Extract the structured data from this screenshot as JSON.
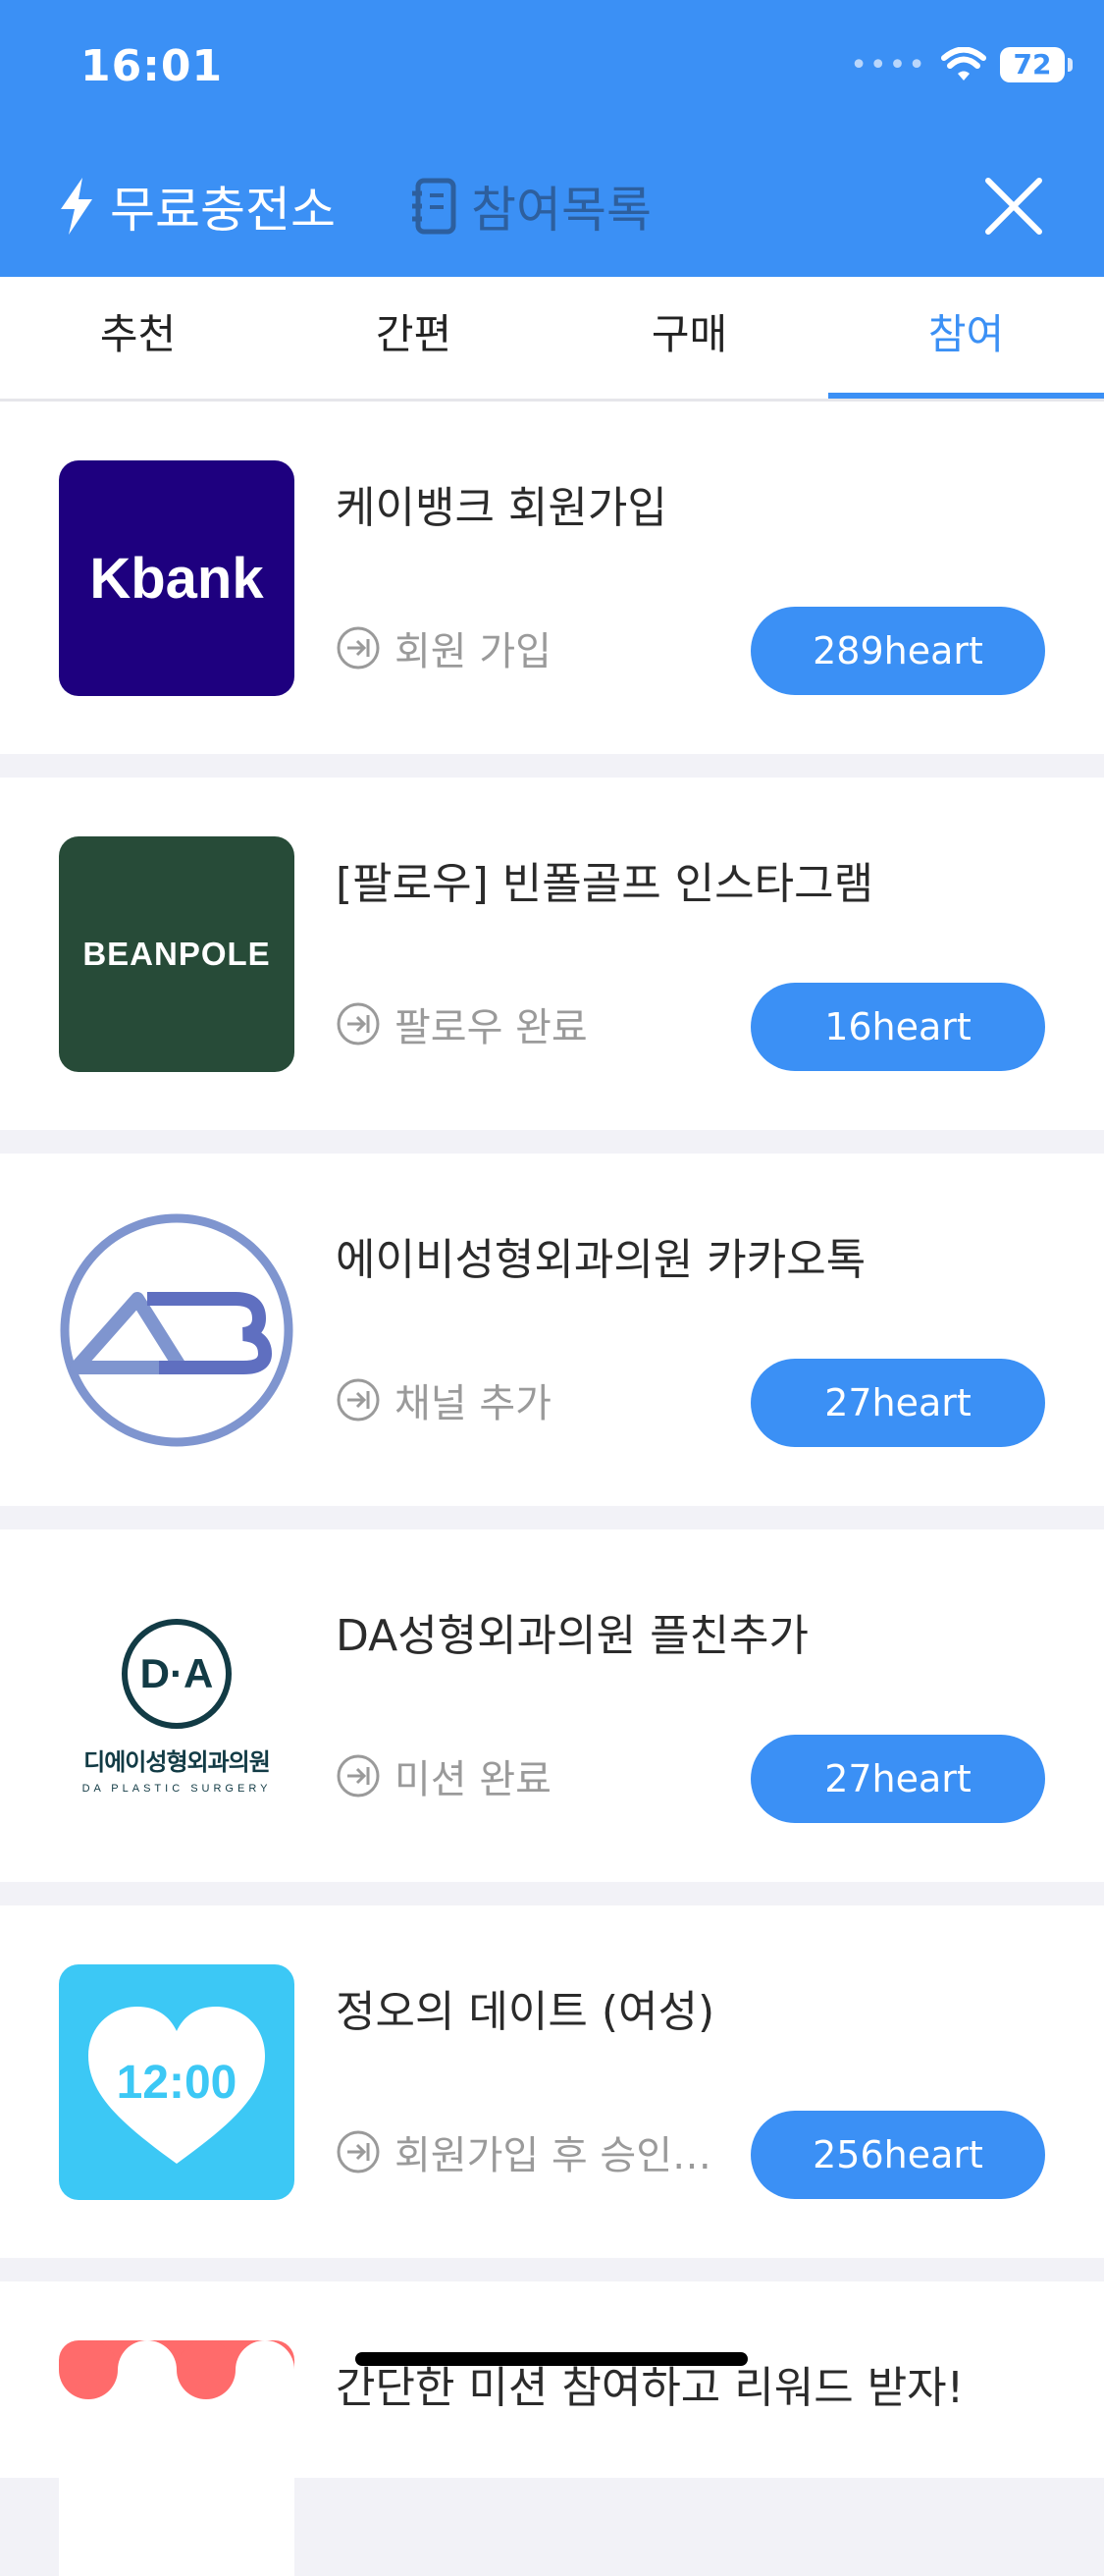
{
  "status_bar": {
    "time": "16:01",
    "battery": "72"
  },
  "header": {
    "charge_label": "무료충전소",
    "history_label": "참여목록"
  },
  "tabs": [
    {
      "label": "추천"
    },
    {
      "label": "간편"
    },
    {
      "label": "구매"
    },
    {
      "label": "참여",
      "active": true
    }
  ],
  "items": [
    {
      "title": "케이뱅크 회원가입",
      "action": "회원 가입",
      "reward": "289heart",
      "logo_text": "Kbank",
      "logo_color": "#1e007f"
    },
    {
      "title": "[팔로우] 빈폴골프 인스타그램",
      "action": "팔로우 완료",
      "reward": "16heart",
      "logo_text": "BEANPOLE",
      "logo_color": "#274b38"
    },
    {
      "title": "에이비성형외과의원 카카오톡",
      "action": "채널 추가",
      "reward": "27heart",
      "logo_text": "AB",
      "logo_color": "#7f95cf"
    },
    {
      "title": "DA성형외과의원 플친추가",
      "action": "미션 완료",
      "reward": "27heart",
      "logo_text": "D·A",
      "logo_sub": "디에이성형외과의원",
      "logo_sub2": "DA PLASTIC SURGERY",
      "logo_color": "#123b45"
    },
    {
      "title": "정오의 데이트 (여성)",
      "action": "회원가입 후 승인…",
      "reward": "256heart",
      "logo_text": "12:00",
      "logo_color": "#3cc8f5"
    }
  ],
  "partial_item": {
    "title": "간단한 미션 참여하고 리워드 받자!"
  }
}
